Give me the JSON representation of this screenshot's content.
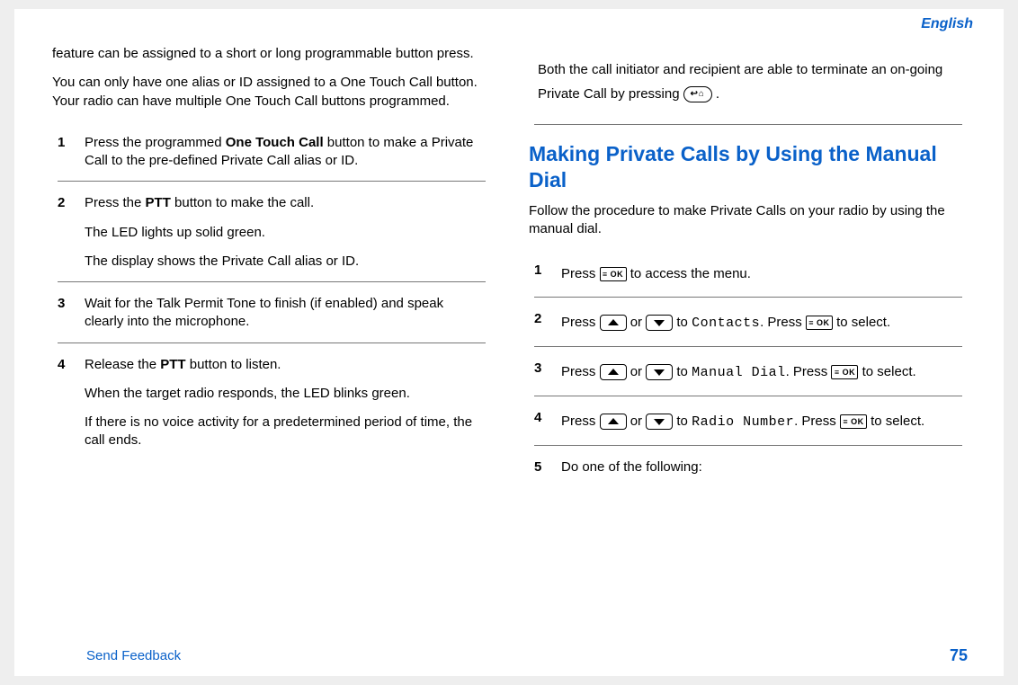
{
  "header": {
    "language": "English"
  },
  "left": {
    "intro1": "feature can be assigned to a short or long programmable button press.",
    "intro2": "You can only have one alias or ID assigned to a One Touch Call button. Your radio can have multiple One Touch Call buttons programmed.",
    "steps": [
      {
        "num": "1",
        "p1a": "Press the programmed ",
        "p1b": "One Touch Call",
        "p1c": " button to make a Private Call to the pre-defined Private Call alias or ID."
      },
      {
        "num": "2",
        "p1a": "Press the ",
        "p1b": "PTT",
        "p1c": " button to make the call.",
        "p2": "The LED lights up solid green.",
        "p3": "The display shows the Private Call alias or ID."
      },
      {
        "num": "3",
        "p1": "Wait for the Talk Permit Tone to finish (if enabled) and speak clearly into the microphone."
      },
      {
        "num": "4",
        "p1a": "Release the ",
        "p1b": "PTT",
        "p1c": " button to listen.",
        "p2": "When the target radio responds, the LED blinks green.",
        "p3": "If there is no voice activity for a predetermined period of time, the call ends."
      }
    ]
  },
  "right": {
    "topline1": "Both the call initiator and recipient are able to terminate an on-going Private Call by pressing ",
    "topline2": " .",
    "heading": "Making Private Calls by Using the Manual Dial",
    "intro": "Follow the procedure to make Private Calls on your radio by using the manual dial.",
    "steps": [
      {
        "num": "1",
        "p_a": "Press ",
        "p_b": " to access the menu."
      },
      {
        "num": "2",
        "p_a": "Press ",
        "p_or": " or ",
        "p_b": " to ",
        "mono": "Contacts",
        "p_c": ". Press ",
        "p_d": " to select."
      },
      {
        "num": "3",
        "p_a": "Press ",
        "p_or": " or ",
        "p_b": " to ",
        "mono": "Manual Dial",
        "p_c": ". Press ",
        "p_d": " to select."
      },
      {
        "num": "4",
        "p_a": "Press ",
        "p_or": " or ",
        "p_b": " to ",
        "mono": "Radio Number",
        "p_c": ". Press ",
        "p_d": " to select."
      },
      {
        "num": "5",
        "p": "Do one of the following:"
      }
    ]
  },
  "footer": {
    "feedback": "Send Feedback",
    "page": "75"
  }
}
